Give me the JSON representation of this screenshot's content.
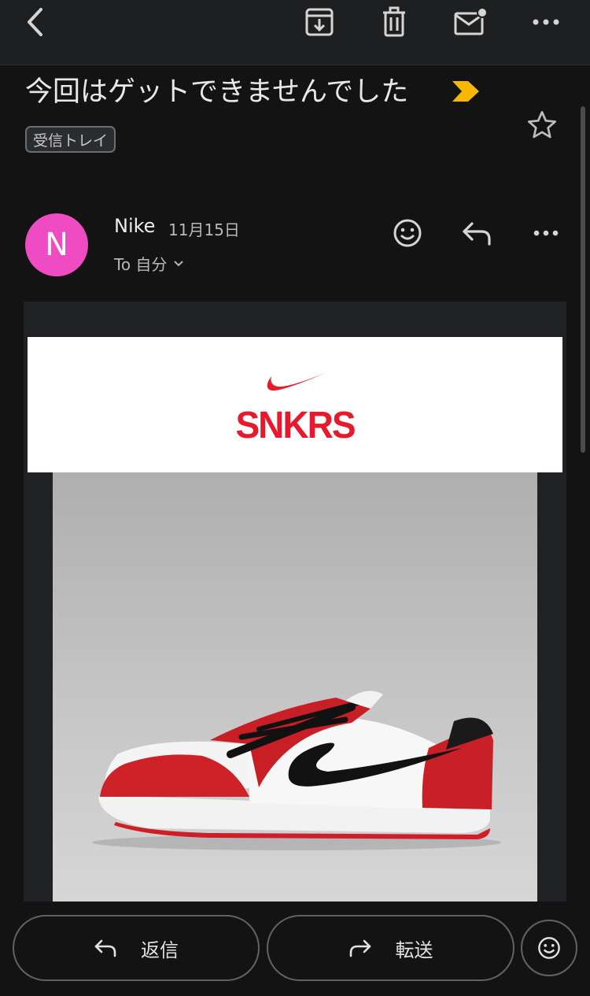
{
  "toolbar": {
    "icons": [
      "back-arrow-icon",
      "archive-icon",
      "trash-icon",
      "mark-unread-icon",
      "more-horizontal-icon"
    ]
  },
  "email": {
    "subject": "今回はゲットできませんでした",
    "label": "受信トレイ",
    "sender_initial": "N",
    "sender": "Nike",
    "date": "11月15日",
    "recipient": "To 自分",
    "brand_text": "SNKRS"
  },
  "actions": {
    "reply_label": "返信",
    "forward_label": "転送"
  },
  "colors": {
    "background": "#131314",
    "avatar": "#ef4bc2",
    "importance_marker": "#f6b800",
    "brand_red": "#e8192c"
  }
}
